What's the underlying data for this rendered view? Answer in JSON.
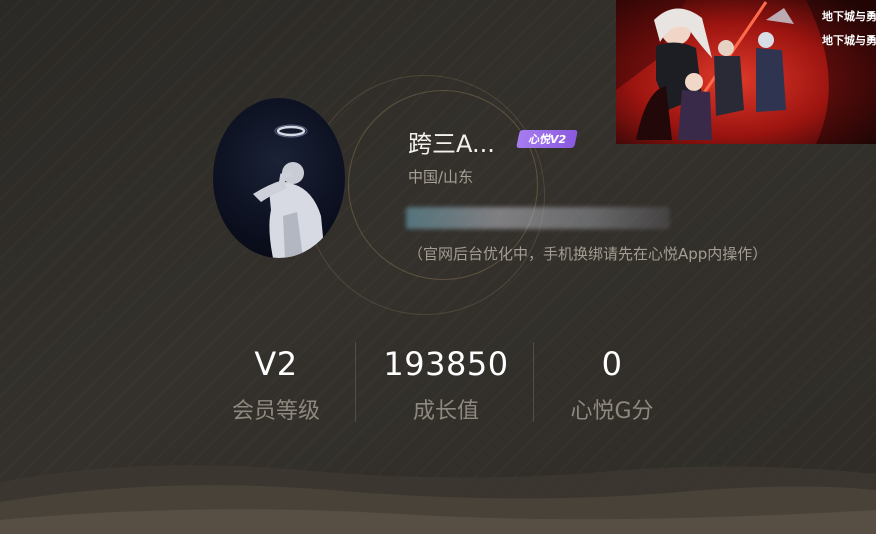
{
  "profile": {
    "username": "跨三A...",
    "vip_badge": "心悦V2",
    "location": "中国/山东",
    "hint": "（官网后台优化中，手机换绑请先在心悦App内操作）"
  },
  "stats": [
    {
      "value": "V2",
      "label": "会员等级"
    },
    {
      "value": "193850",
      "label": "成长值"
    },
    {
      "value": "0",
      "label": "心悦G分"
    }
  ],
  "banner": {
    "logo_text_1": "地下城与勇士",
    "logo_text_2": "地下城与勇士"
  },
  "colors": {
    "background": "#2f2c28",
    "vip_badge": "#9a6ae8",
    "accent_ring": "#c8aa6e",
    "label_gray": "#8e887e"
  }
}
